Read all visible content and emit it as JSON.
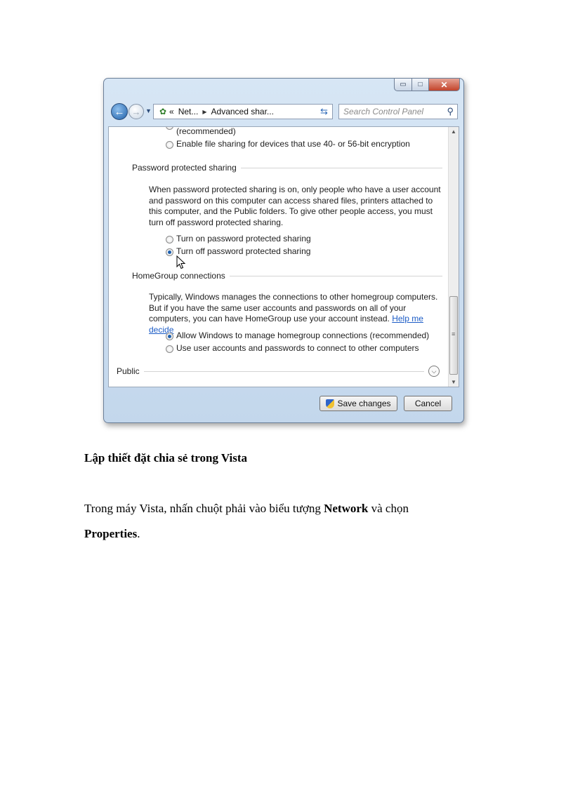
{
  "window": {
    "controls": {
      "minimize": "▭",
      "maximize": "□",
      "close": "✕"
    },
    "nav": {
      "back_icon": "back-arrow-icon",
      "forward_icon": "forward-arrow-icon"
    },
    "address": {
      "overflow": "«",
      "crumb1": "Net...",
      "crumb2": "Advanced shar..."
    },
    "search": {
      "placeholder": "Search Control Panel"
    }
  },
  "content": {
    "top_option_fragment": "(recommended)",
    "top_option_2": "Enable file sharing for devices that use 40- or 56-bit encryption",
    "password_section": {
      "title": "Password protected sharing",
      "description": "When password protected sharing is on, only people who have a user account and password on this computer can access shared files, printers attached to this computer, and the Public folders. To give other people access, you must turn off password protected sharing.",
      "options": [
        {
          "label": "Turn on password protected sharing",
          "selected": false
        },
        {
          "label": "Turn off password protected sharing",
          "selected": true
        }
      ]
    },
    "homegroup_section": {
      "title": "HomeGroup connections",
      "description": "Typically, Windows manages the connections to other homegroup computers. But if you have the same user accounts and passwords on all of your computers, you can have HomeGroup use your account instead.",
      "link": "Help me decide",
      "options": [
        {
          "label": "Allow Windows to manage homegroup connections (recommended)",
          "selected": true
        },
        {
          "label": "Use user accounts and passwords to connect to other computers",
          "selected": false
        }
      ]
    },
    "public_section": {
      "title": "Public"
    }
  },
  "buttons": {
    "save": "Save changes",
    "cancel": "Cancel"
  },
  "document": {
    "heading": "Lập thiết đặt chia sẻ trong Vista",
    "body_prefix": "Trong máy Vista, nhấn chuột phải vào biểu tượng ",
    "body_bold1": "Network",
    "body_middle": " và chọn ",
    "body_bold2": "Properties",
    "body_suffix": "."
  }
}
